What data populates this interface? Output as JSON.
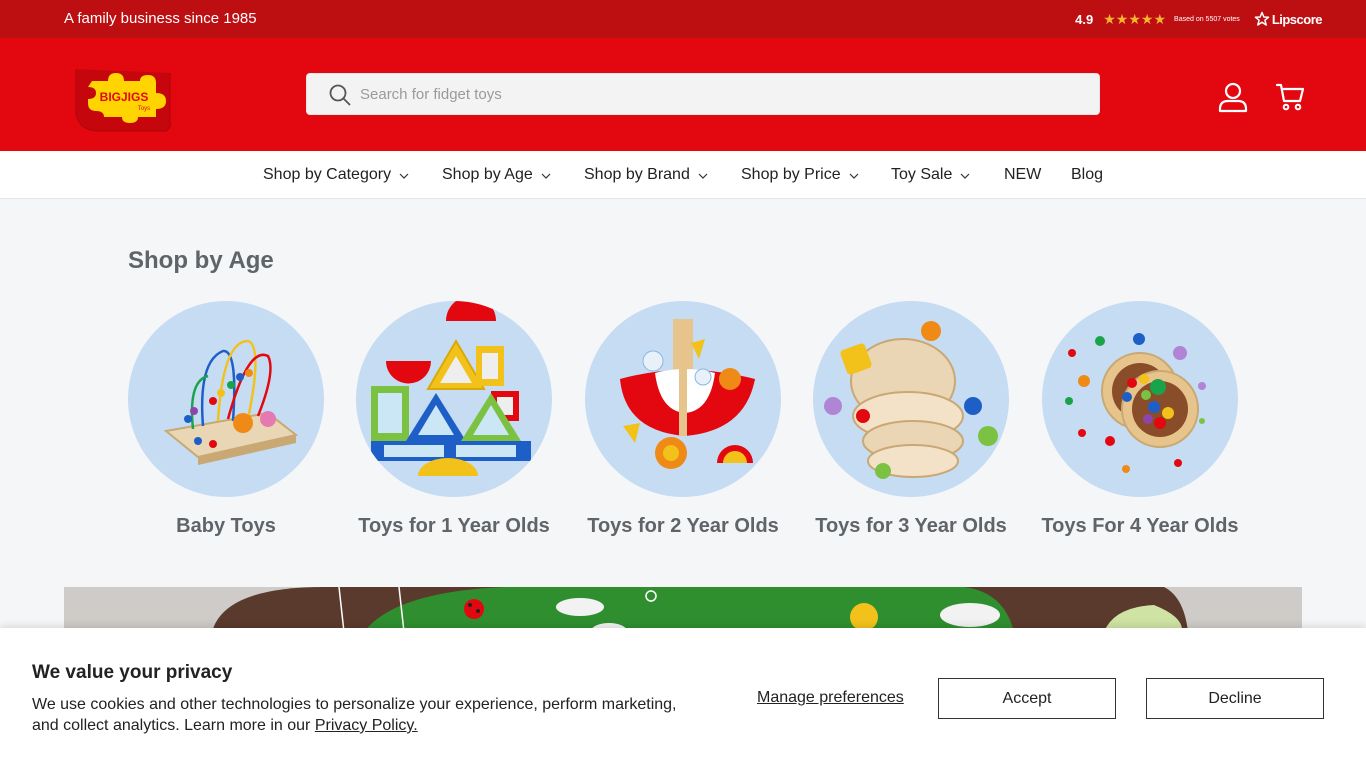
{
  "topbar": {
    "tagline": "A family business since 1985",
    "rating_score": "4.9",
    "rating_value": 4.9,
    "rating_max": 5,
    "votes_text": "Based on 5507 votes",
    "lipscore_label": "Lipscore"
  },
  "header": {
    "logo_alt": "BIGJIGS Toys",
    "search_placeholder": "Search for fidget toys"
  },
  "nav": {
    "items": [
      {
        "label": "Shop by Category",
        "dropdown": true
      },
      {
        "label": "Shop by Age",
        "dropdown": true
      },
      {
        "label": "Shop by Brand",
        "dropdown": true
      },
      {
        "label": "Shop by Price",
        "dropdown": true
      },
      {
        "label": "Toy Sale",
        "dropdown": true
      },
      {
        "label": "NEW",
        "dropdown": false
      },
      {
        "label": "Blog",
        "dropdown": false
      }
    ]
  },
  "shop_by_age": {
    "title": "Shop by Age",
    "cards": [
      {
        "label": "Baby Toys"
      },
      {
        "label": "Toys for 1 Year Olds"
      },
      {
        "label": "Toys for 2 Year Olds"
      },
      {
        "label": "Toys for 3 Year Olds"
      },
      {
        "label": "Toys For 4 Year Olds"
      }
    ]
  },
  "cookie_banner": {
    "title": "We value your privacy",
    "text": "We use cookies and other technologies to personalize your experience, perform marketing, and collect analytics. Learn more in our ",
    "privacy_link": "Privacy Policy.",
    "manage_label": "Manage preferences",
    "accept_label": "Accept",
    "decline_label": "Decline"
  },
  "colors": {
    "topbar": "#bd0f12",
    "header": "#e3080f",
    "star": "#f5b52e",
    "circle_bg": "#c5dcf3"
  }
}
